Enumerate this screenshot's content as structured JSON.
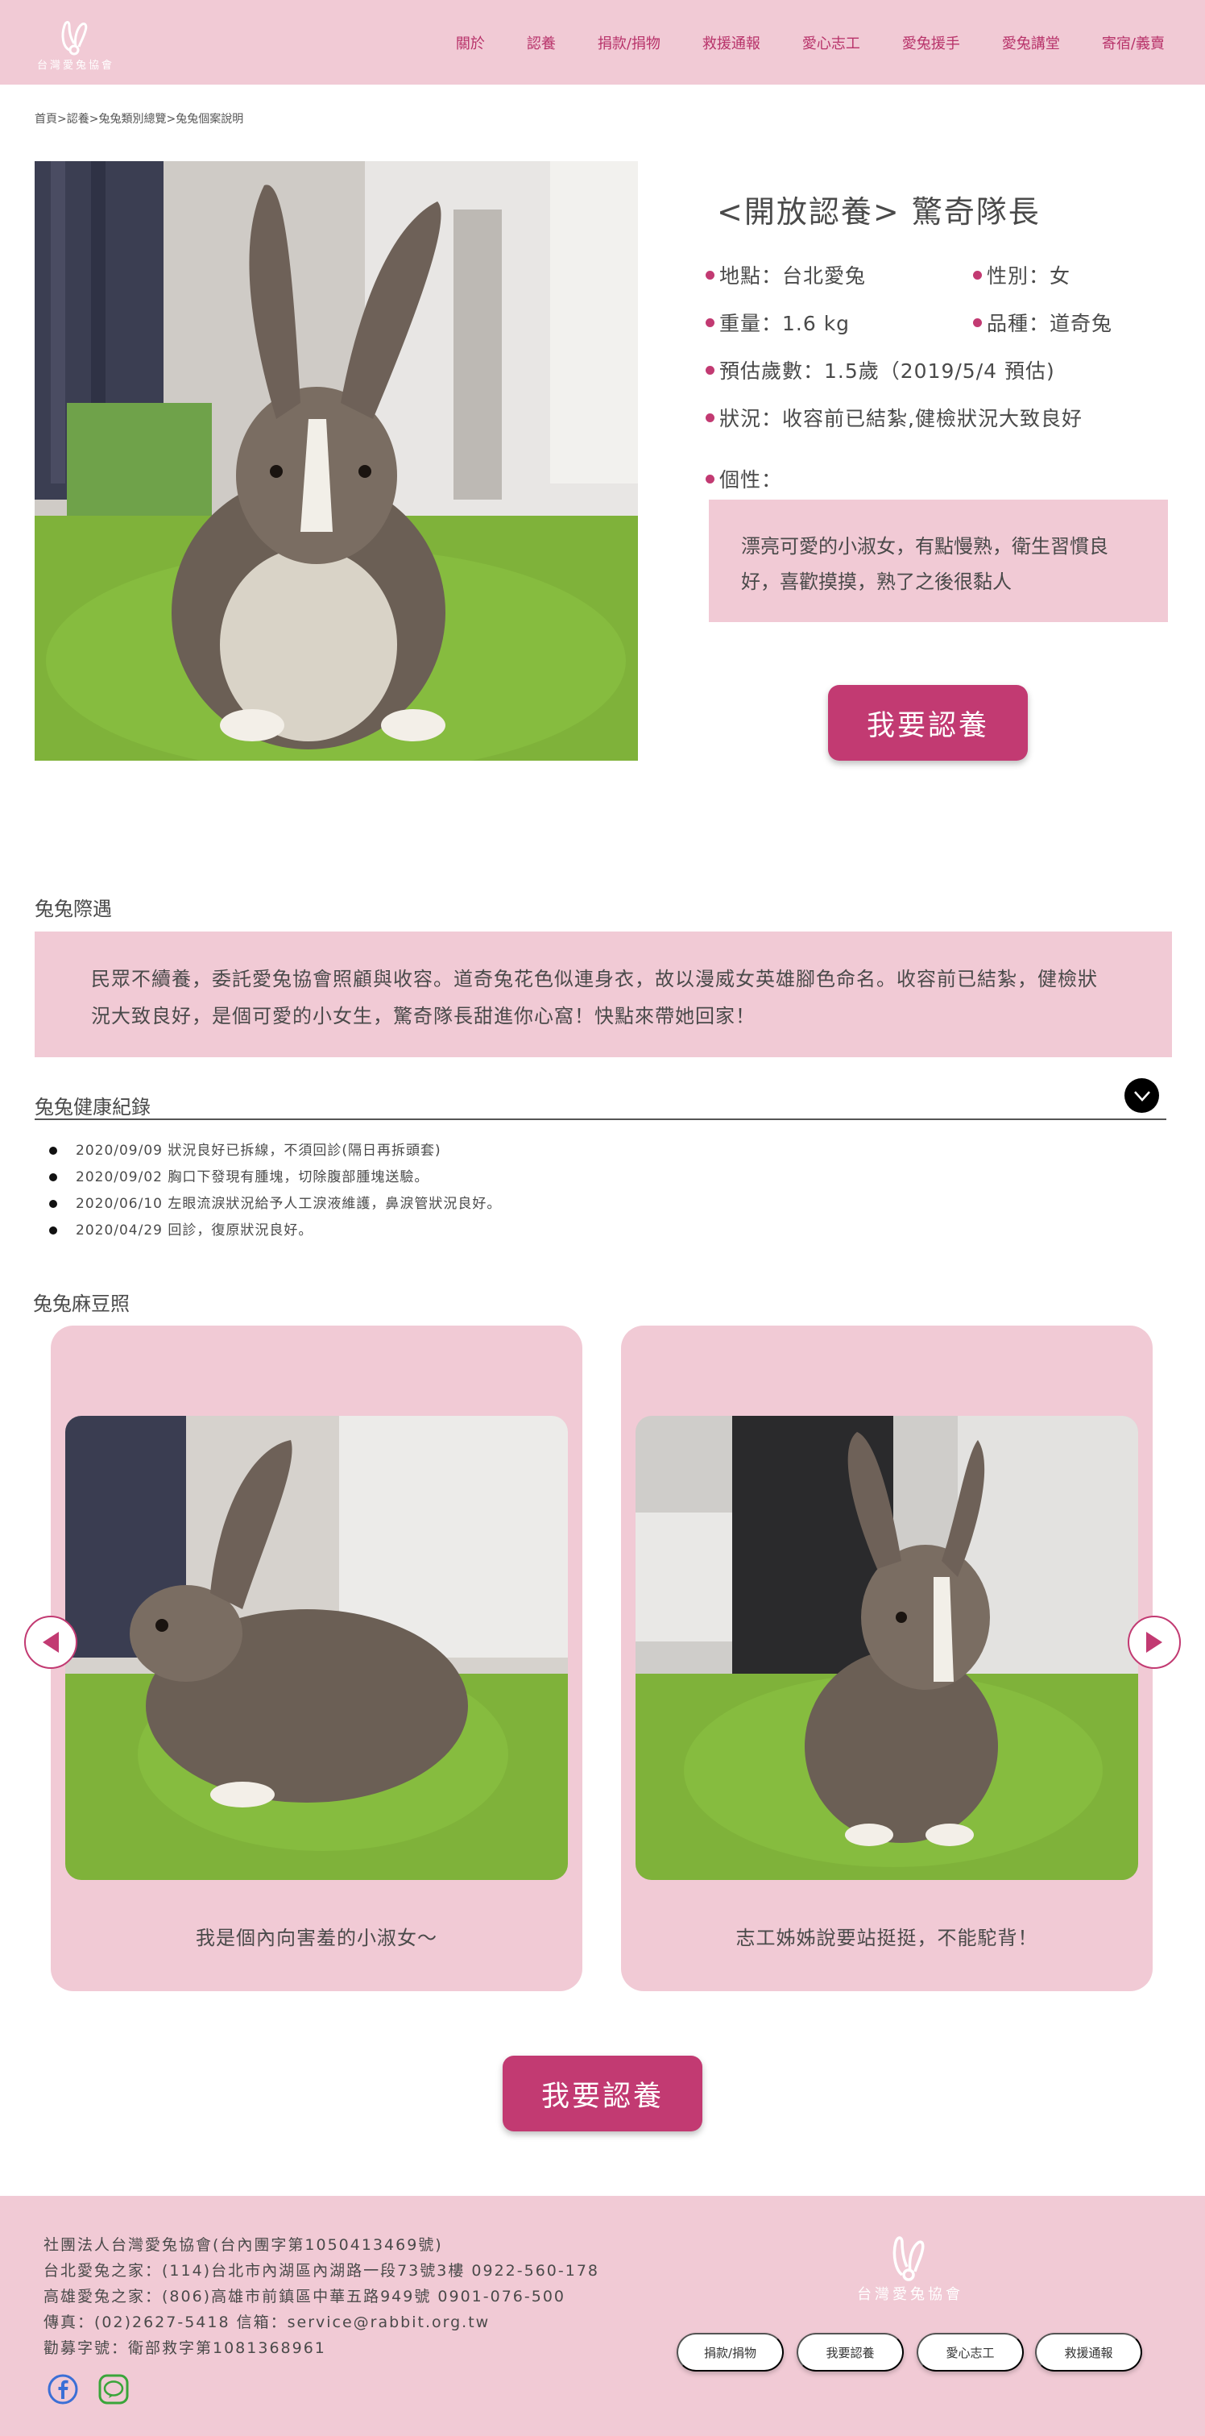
{
  "header": {
    "logo_text": "台灣愛兔協會",
    "nav": [
      "關於",
      "認養",
      "捐款/捐物",
      "救援通報",
      "愛心志工",
      "愛兔援手",
      "愛兔講堂",
      "寄宿/義賣"
    ]
  },
  "breadcrumb": "首頁>認養>兔兔類別總覽>兔兔個案說明",
  "rabbit": {
    "title": "<開放認養>  驚奇隊長",
    "location": "地點：台北愛兔",
    "gender": "性別：女",
    "weight": "重量：1.6 kg",
    "breed": "品種：道奇兔",
    "age": "預估歲數：1.5歲（2019/5/4 預估)",
    "status": "狀況：收容前已結紮,健檢狀況大致良好",
    "personality_label": "個性：",
    "personality": "漂亮可愛的小淑女，有點慢熟，衛生習慣良好，喜歡摸摸，熟了之後很黏人"
  },
  "adopt_label": "我要認養",
  "story": {
    "title": "兔兔際遇",
    "text": "民眾不續養，委託愛兔協會照顧與收容。道奇兔花色似連身衣，故以漫威女英雄腳色命名。收容前已結紮，健檢狀況大致良好，是個可愛的小女生，驚奇隊長甜進你心窩！快點來帶她回家！"
  },
  "health": {
    "title": "兔兔健康紀錄",
    "records": [
      "2020/09/09 狀況良好已拆線，不須回診(隔日再拆頭套)",
      "2020/09/02 胸口下發現有腫塊，切除腹部腫塊送驗。",
      "2020/06/10 左眼流淚狀況給予人工淚液維護，鼻淚管狀況良好。",
      "2020/04/29 回診，復原狀況良好。"
    ]
  },
  "gallery": {
    "title": "兔兔麻豆照",
    "captions": [
      "我是個內向害羞的小淑女～",
      "志工姊姊說要站挺挺，不能駝背！"
    ]
  },
  "footer": {
    "lines": [
      "社團法人台灣愛兔協會(台內團字第1050413469號)",
      "台北愛兔之家：(114)台北市內湖區內湖路一段73號3樓  0922-560-178",
      "高雄愛兔之家：(806)高雄市前鎮區中華五路949號   0901-076-500",
      "傳真：(02)2627-5418   信箱：service@rabbit.org.tw",
      "勸募字號：衛部救字第1081368961"
    ],
    "logo_text": "台灣愛兔協會",
    "buttons": [
      "捐款/捐物",
      "我要認養",
      "愛心志工",
      "救援通報"
    ]
  },
  "colors": {
    "pink": "#f1cad5",
    "accent": "#c23a72",
    "grass": "#7fb23a"
  },
  "icons": [
    "rabbit-logo-icon",
    "chevron-down-icon",
    "arrow-left-icon",
    "arrow-right-icon",
    "facebook-icon",
    "line-icon"
  ]
}
